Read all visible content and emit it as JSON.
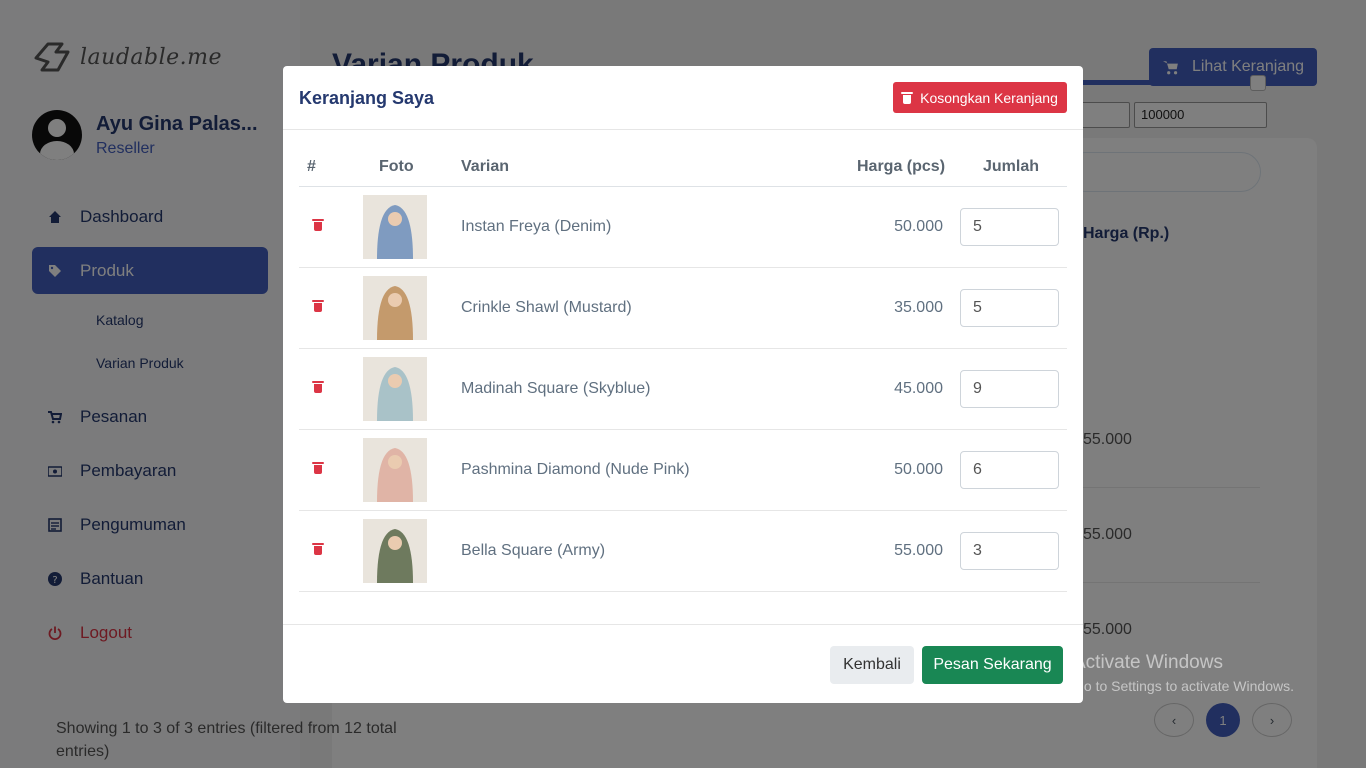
{
  "sidebar": {
    "logo_text": "laudable.me",
    "user_name": "Ayu Gina Palas...",
    "user_role": "Reseller",
    "menu": {
      "dashboard": "Dashboard",
      "produk": "Produk",
      "katalog": "Katalog",
      "varian_produk": "Varian Produk",
      "pesanan": "Pesanan",
      "pembayaran": "Pembayaran",
      "pengumuman": "Pengumuman",
      "bantuan": "Bantuan",
      "logout": "Logout"
    }
  },
  "page": {
    "title": "Varian Produk",
    "cart_button": "Lihat Keranjang",
    "range_max": "100000",
    "price_header": "Harga (Rp.)",
    "prices": [
      "55.000",
      "55.000",
      "55.000"
    ],
    "entries_info": "Showing 1 to 3 of 3 entries (filtered from 12 total entries)",
    "pager_prev": "‹",
    "pager_current": "1",
    "pager_next": "›"
  },
  "modal": {
    "title": "Keranjang Saya",
    "empty_button": "Kosongkan Keranjang",
    "columns": {
      "num": "#",
      "foto": "Foto",
      "varian": "Varian",
      "harga": "Harga (pcs)",
      "jumlah": "Jumlah"
    },
    "items": [
      {
        "name": "Instan Freya (Denim)",
        "price": "50.000",
        "qty": "5",
        "thumb_color": "#7f9bc0"
      },
      {
        "name": "Crinkle Shawl (Mustard)",
        "price": "35.000",
        "qty": "5",
        "thumb_color": "#c49a6c"
      },
      {
        "name": "Madinah Square (Skyblue)",
        "price": "45.000",
        "qty": "9",
        "thumb_color": "#a9c2c8"
      },
      {
        "name": "Pashmina Diamond (Nude Pink)",
        "price": "50.000",
        "qty": "6",
        "thumb_color": "#e0b4a6"
      },
      {
        "name": "Bella Square (Army)",
        "price": "55.000",
        "qty": "3",
        "thumb_color": "#6e7a5e"
      }
    ],
    "back_button": "Kembali",
    "order_button": "Pesan Sekarang"
  },
  "watermark": {
    "line1": "Activate Windows",
    "line2": "Go to Settings to activate Windows."
  },
  "colors": {
    "primary": "#435ebe",
    "danger": "#dc3545",
    "success": "#198754"
  }
}
